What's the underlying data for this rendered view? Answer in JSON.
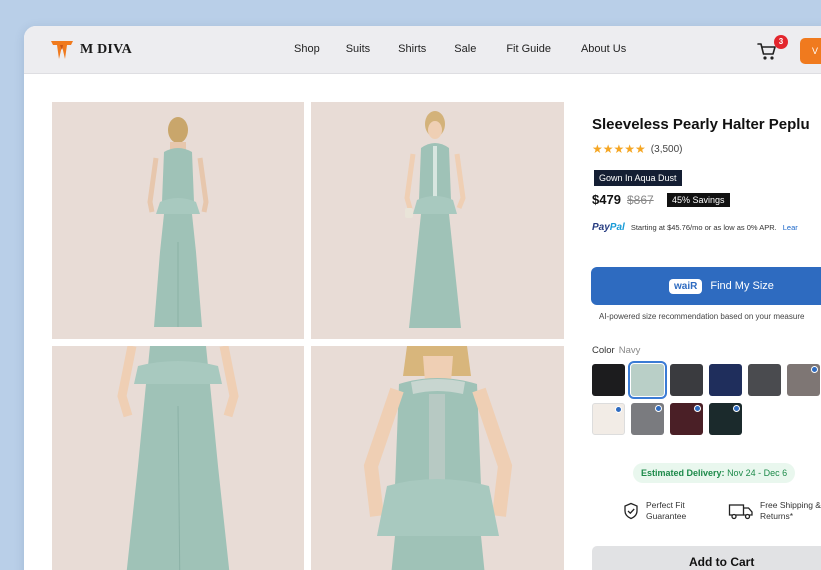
{
  "header": {
    "brand": "M DIVA",
    "nav": [
      "Shop",
      "Suits",
      "Shirts",
      "Sale",
      "Fit Guide",
      "About Us"
    ],
    "cart_count": "3",
    "button_label": "V"
  },
  "product": {
    "title": "Sleeveless Pearly Halter Peplu",
    "stars": "★★★★★",
    "rating_count": "(3,500)",
    "variant_tag": "Gown In Aqua Dust",
    "price": "$479",
    "old_price": "$867",
    "savings": "45% Savings",
    "paypal": {
      "brand_a": "Pay",
      "brand_b": "Pal",
      "text": "Starting at $45.76/mo or as low as 0% APR.",
      "link": "Lear"
    },
    "find_size": {
      "logo": "waiR",
      "label": "Find My Size",
      "note": "AI-powered size recommendation based on your measure"
    },
    "color": {
      "label": "Color",
      "value": "Navy",
      "swatches": [
        {
          "hex": "#1c1c1e",
          "selected": false,
          "le": false
        },
        {
          "hex": "#b9cfc7",
          "selected": true,
          "le": false
        },
        {
          "hex": "#3a3b3f",
          "selected": false,
          "le": false
        },
        {
          "hex": "#1f2e5c",
          "selected": false,
          "le": false
        },
        {
          "hex": "#4a4b4f",
          "selected": false,
          "le": false
        },
        {
          "hex": "#7e7674",
          "selected": false,
          "le": true
        },
        {
          "hex": "#f2ece6",
          "selected": false,
          "le": true
        },
        {
          "hex": "#7a7b7f",
          "selected": false,
          "le": true
        },
        {
          "hex": "#4a1f26",
          "selected": false,
          "le": true
        },
        {
          "hex": "#1b2a2c",
          "selected": false,
          "le": true
        }
      ]
    },
    "delivery": {
      "label": "Estimated Delivery:",
      "value": "Nov 24 - Dec 6"
    },
    "features": [
      {
        "icon": "shield-check-icon",
        "text": "Perfect Fit Guarantee"
      },
      {
        "icon": "truck-icon",
        "text": "Free Shipping & Returns*"
      }
    ],
    "add_to_cart": "Add to Cart"
  },
  "colors": {
    "accent_blue": "#2e6bc0",
    "orange": "#f07a1e",
    "gown": "#9fc2b7",
    "photo_bg": "#e8dcd6"
  }
}
